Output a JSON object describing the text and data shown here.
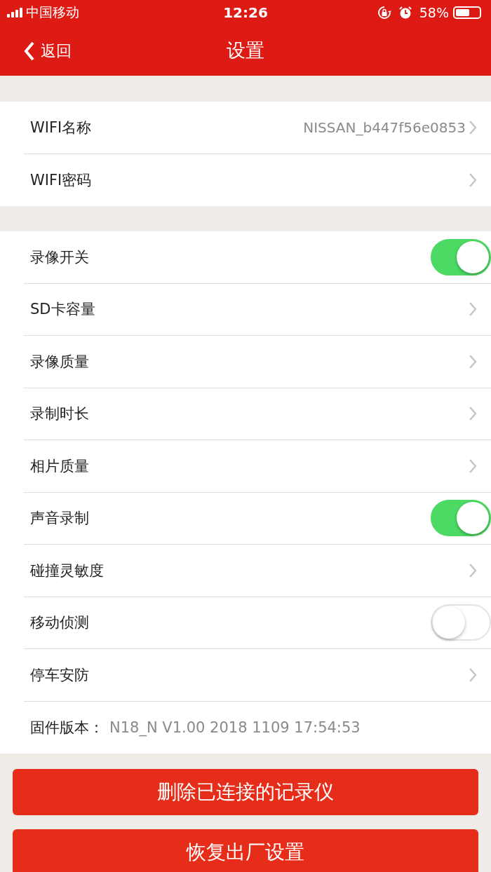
{
  "status_bar": {
    "carrier": "中国移动",
    "time": "12:26",
    "battery": "58%"
  },
  "nav": {
    "back": "返回",
    "title": "设置"
  },
  "groups": [
    {
      "items": [
        {
          "kind": "link",
          "label": "WIFI名称",
          "value": "NISSAN_b447f56e0853"
        },
        {
          "kind": "link",
          "label": "WIFI密码"
        }
      ]
    },
    {
      "items": [
        {
          "kind": "toggle",
          "label": "录像开关",
          "on": true
        },
        {
          "kind": "link",
          "label": "SD卡容量"
        },
        {
          "kind": "link",
          "label": "录像质量"
        },
        {
          "kind": "link",
          "label": "录制时长"
        },
        {
          "kind": "link",
          "label": "相片质量"
        },
        {
          "kind": "toggle",
          "label": "声音录制",
          "on": true
        },
        {
          "kind": "link",
          "label": "碰撞灵敏度"
        },
        {
          "kind": "toggle",
          "label": "移动侦测",
          "on": false
        },
        {
          "kind": "link",
          "label": "停车安防"
        },
        {
          "kind": "info",
          "label": "固件版本：",
          "value": "N18_N V1.00 2018 1109 17:54:53"
        }
      ]
    }
  ],
  "buttons": [
    "删除已连接的记录仪",
    "恢复出厂设置"
  ]
}
